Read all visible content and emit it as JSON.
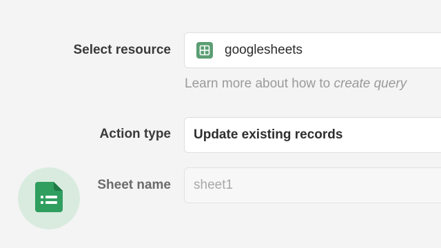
{
  "form": {
    "resource": {
      "label": "Select resource",
      "value": "googlesheets",
      "icon": "google-sheets-icon",
      "help_text": "Learn more about how to ",
      "help_link": "create query"
    },
    "action_type": {
      "label": "Action type",
      "value": "Update existing records"
    },
    "sheet_name": {
      "label": "Sheet name",
      "placeholder": "sheet1",
      "value": ""
    }
  },
  "badge": {
    "icon": "google-sheets-file-icon"
  },
  "colors": {
    "background": "#f4f4f4",
    "sheets_green": "#2f9e5f",
    "badge_bg": "#d9ebdf",
    "label_text": "#3a3a3a",
    "help_text": "#9a9a9a"
  }
}
